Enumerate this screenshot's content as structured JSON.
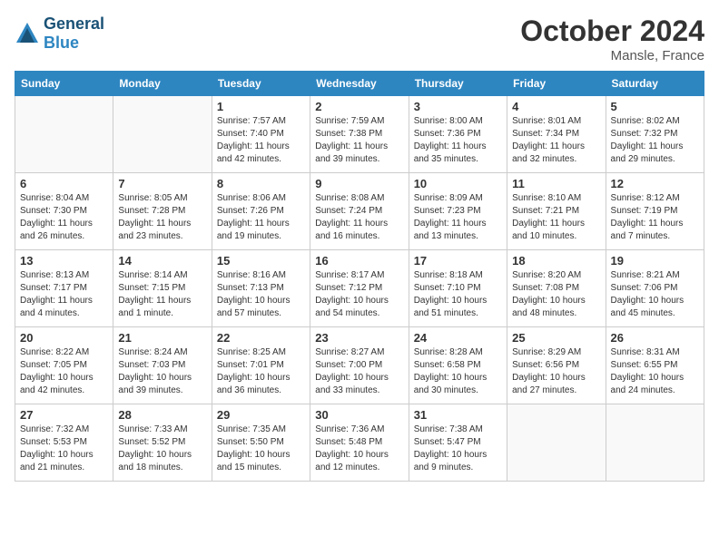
{
  "header": {
    "logo_general": "General",
    "logo_blue": "Blue",
    "month_title": "October 2024",
    "location": "Mansle, France"
  },
  "days_of_week": [
    "Sunday",
    "Monday",
    "Tuesday",
    "Wednesday",
    "Thursday",
    "Friday",
    "Saturday"
  ],
  "weeks": [
    [
      {
        "day": "",
        "empty": true
      },
      {
        "day": "",
        "empty": true
      },
      {
        "day": "1",
        "sunrise": "Sunrise: 7:57 AM",
        "sunset": "Sunset: 7:40 PM",
        "daylight": "Daylight: 11 hours and 42 minutes."
      },
      {
        "day": "2",
        "sunrise": "Sunrise: 7:59 AM",
        "sunset": "Sunset: 7:38 PM",
        "daylight": "Daylight: 11 hours and 39 minutes."
      },
      {
        "day": "3",
        "sunrise": "Sunrise: 8:00 AM",
        "sunset": "Sunset: 7:36 PM",
        "daylight": "Daylight: 11 hours and 35 minutes."
      },
      {
        "day": "4",
        "sunrise": "Sunrise: 8:01 AM",
        "sunset": "Sunset: 7:34 PM",
        "daylight": "Daylight: 11 hours and 32 minutes."
      },
      {
        "day": "5",
        "sunrise": "Sunrise: 8:02 AM",
        "sunset": "Sunset: 7:32 PM",
        "daylight": "Daylight: 11 hours and 29 minutes."
      }
    ],
    [
      {
        "day": "6",
        "sunrise": "Sunrise: 8:04 AM",
        "sunset": "Sunset: 7:30 PM",
        "daylight": "Daylight: 11 hours and 26 minutes."
      },
      {
        "day": "7",
        "sunrise": "Sunrise: 8:05 AM",
        "sunset": "Sunset: 7:28 PM",
        "daylight": "Daylight: 11 hours and 23 minutes."
      },
      {
        "day": "8",
        "sunrise": "Sunrise: 8:06 AM",
        "sunset": "Sunset: 7:26 PM",
        "daylight": "Daylight: 11 hours and 19 minutes."
      },
      {
        "day": "9",
        "sunrise": "Sunrise: 8:08 AM",
        "sunset": "Sunset: 7:24 PM",
        "daylight": "Daylight: 11 hours and 16 minutes."
      },
      {
        "day": "10",
        "sunrise": "Sunrise: 8:09 AM",
        "sunset": "Sunset: 7:23 PM",
        "daylight": "Daylight: 11 hours and 13 minutes."
      },
      {
        "day": "11",
        "sunrise": "Sunrise: 8:10 AM",
        "sunset": "Sunset: 7:21 PM",
        "daylight": "Daylight: 11 hours and 10 minutes."
      },
      {
        "day": "12",
        "sunrise": "Sunrise: 8:12 AM",
        "sunset": "Sunset: 7:19 PM",
        "daylight": "Daylight: 11 hours and 7 minutes."
      }
    ],
    [
      {
        "day": "13",
        "sunrise": "Sunrise: 8:13 AM",
        "sunset": "Sunset: 7:17 PM",
        "daylight": "Daylight: 11 hours and 4 minutes."
      },
      {
        "day": "14",
        "sunrise": "Sunrise: 8:14 AM",
        "sunset": "Sunset: 7:15 PM",
        "daylight": "Daylight: 11 hours and 1 minute."
      },
      {
        "day": "15",
        "sunrise": "Sunrise: 8:16 AM",
        "sunset": "Sunset: 7:13 PM",
        "daylight": "Daylight: 10 hours and 57 minutes."
      },
      {
        "day": "16",
        "sunrise": "Sunrise: 8:17 AM",
        "sunset": "Sunset: 7:12 PM",
        "daylight": "Daylight: 10 hours and 54 minutes."
      },
      {
        "day": "17",
        "sunrise": "Sunrise: 8:18 AM",
        "sunset": "Sunset: 7:10 PM",
        "daylight": "Daylight: 10 hours and 51 minutes."
      },
      {
        "day": "18",
        "sunrise": "Sunrise: 8:20 AM",
        "sunset": "Sunset: 7:08 PM",
        "daylight": "Daylight: 10 hours and 48 minutes."
      },
      {
        "day": "19",
        "sunrise": "Sunrise: 8:21 AM",
        "sunset": "Sunset: 7:06 PM",
        "daylight": "Daylight: 10 hours and 45 minutes."
      }
    ],
    [
      {
        "day": "20",
        "sunrise": "Sunrise: 8:22 AM",
        "sunset": "Sunset: 7:05 PM",
        "daylight": "Daylight: 10 hours and 42 minutes."
      },
      {
        "day": "21",
        "sunrise": "Sunrise: 8:24 AM",
        "sunset": "Sunset: 7:03 PM",
        "daylight": "Daylight: 10 hours and 39 minutes."
      },
      {
        "day": "22",
        "sunrise": "Sunrise: 8:25 AM",
        "sunset": "Sunset: 7:01 PM",
        "daylight": "Daylight: 10 hours and 36 minutes."
      },
      {
        "day": "23",
        "sunrise": "Sunrise: 8:27 AM",
        "sunset": "Sunset: 7:00 PM",
        "daylight": "Daylight: 10 hours and 33 minutes."
      },
      {
        "day": "24",
        "sunrise": "Sunrise: 8:28 AM",
        "sunset": "Sunset: 6:58 PM",
        "daylight": "Daylight: 10 hours and 30 minutes."
      },
      {
        "day": "25",
        "sunrise": "Sunrise: 8:29 AM",
        "sunset": "Sunset: 6:56 PM",
        "daylight": "Daylight: 10 hours and 27 minutes."
      },
      {
        "day": "26",
        "sunrise": "Sunrise: 8:31 AM",
        "sunset": "Sunset: 6:55 PM",
        "daylight": "Daylight: 10 hours and 24 minutes."
      }
    ],
    [
      {
        "day": "27",
        "sunrise": "Sunrise: 7:32 AM",
        "sunset": "Sunset: 5:53 PM",
        "daylight": "Daylight: 10 hours and 21 minutes."
      },
      {
        "day": "28",
        "sunrise": "Sunrise: 7:33 AM",
        "sunset": "Sunset: 5:52 PM",
        "daylight": "Daylight: 10 hours and 18 minutes."
      },
      {
        "day": "29",
        "sunrise": "Sunrise: 7:35 AM",
        "sunset": "Sunset: 5:50 PM",
        "daylight": "Daylight: 10 hours and 15 minutes."
      },
      {
        "day": "30",
        "sunrise": "Sunrise: 7:36 AM",
        "sunset": "Sunset: 5:48 PM",
        "daylight": "Daylight: 10 hours and 12 minutes."
      },
      {
        "day": "31",
        "sunrise": "Sunrise: 7:38 AM",
        "sunset": "Sunset: 5:47 PM",
        "daylight": "Daylight: 10 hours and 9 minutes."
      },
      {
        "day": "",
        "empty": true
      },
      {
        "day": "",
        "empty": true
      }
    ]
  ]
}
